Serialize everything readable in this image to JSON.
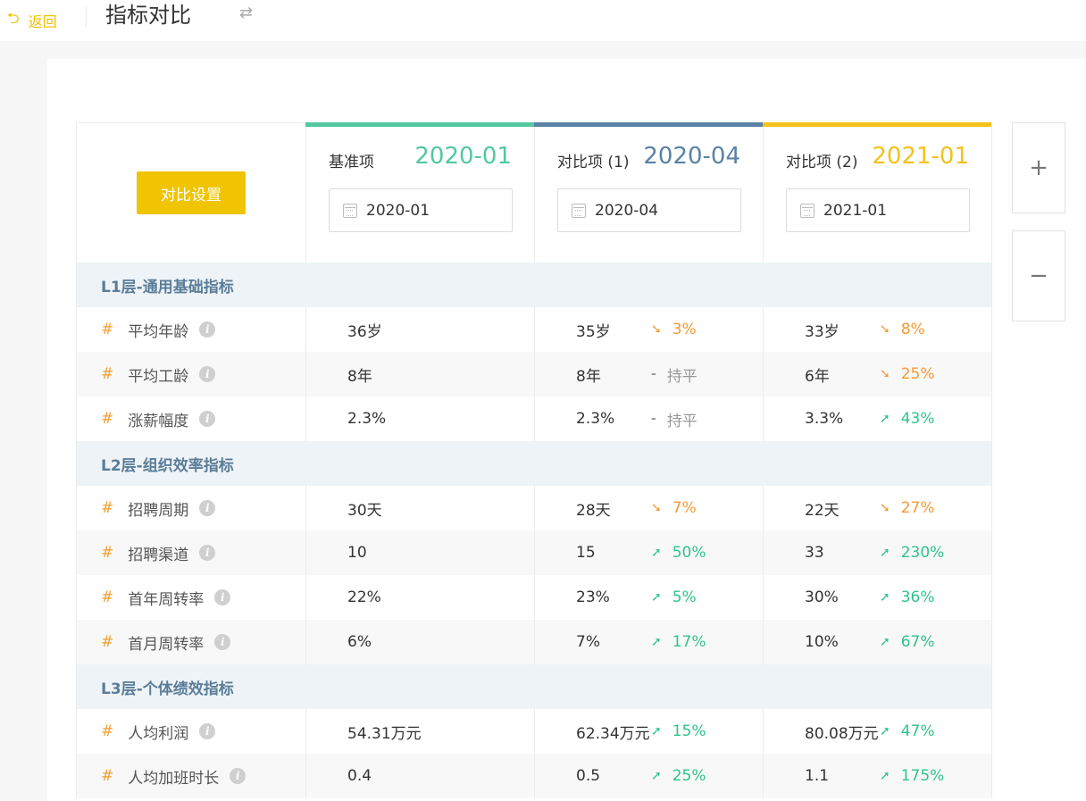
{
  "header": {
    "back_label": "返回",
    "title": "指标对比",
    "back_icon": "undo-arrow-icon",
    "swap_icon": "swap-arrows-icon"
  },
  "settings_button": "对比设置",
  "columns": [
    {
      "label": "基准项",
      "period": "2020-01",
      "picker_value": "2020-01",
      "color": "#52c8a0"
    },
    {
      "label": "对比项 (1)",
      "period": "2020-04",
      "picker_value": "2020-04",
      "color": "#5a82a6"
    },
    {
      "label": "对比项 (2)",
      "period": "2021-01",
      "picker_value": "2021-01",
      "color": "#f3c21b"
    }
  ],
  "sections": [
    {
      "title": "L1层-通用基础指标",
      "rows": [
        {
          "name": "平均年龄",
          "base": "36岁",
          "c1": {
            "value": "35岁",
            "dir": "down",
            "change": "3%"
          },
          "c2": {
            "value": "33岁",
            "dir": "down",
            "change": "8%"
          }
        },
        {
          "name": "平均工龄",
          "base": "8年",
          "c1": {
            "value": "8年",
            "dir": "flat",
            "change": "持平"
          },
          "c2": {
            "value": "6年",
            "dir": "down",
            "change": "25%"
          }
        },
        {
          "name": "涨薪幅度",
          "base": "2.3%",
          "c1": {
            "value": "2.3%",
            "dir": "flat",
            "change": "持平"
          },
          "c2": {
            "value": "3.3%",
            "dir": "up",
            "change": "43%"
          }
        }
      ]
    },
    {
      "title": "L2层-组织效率指标",
      "rows": [
        {
          "name": "招聘周期",
          "base": "30天",
          "c1": {
            "value": "28天",
            "dir": "down",
            "change": "7%"
          },
          "c2": {
            "value": "22天",
            "dir": "down",
            "change": "27%"
          }
        },
        {
          "name": "招聘渠道",
          "base": "10",
          "c1": {
            "value": "15",
            "dir": "up",
            "change": "50%"
          },
          "c2": {
            "value": "33",
            "dir": "up",
            "change": "230%"
          }
        },
        {
          "name": "首年周转率",
          "base": "22%",
          "c1": {
            "value": "23%",
            "dir": "up",
            "change": "5%"
          },
          "c2": {
            "value": "30%",
            "dir": "up",
            "change": "36%"
          }
        },
        {
          "name": "首月周转率",
          "base": "6%",
          "c1": {
            "value": "7%",
            "dir": "up",
            "change": "17%"
          },
          "c2": {
            "value": "10%",
            "dir": "up",
            "change": "67%"
          }
        }
      ]
    },
    {
      "title": "L3层-个体绩效指标",
      "rows": [
        {
          "name": "人均利润",
          "base": "54.31万元",
          "c1": {
            "value": "62.34万元",
            "dir": "up",
            "change": "15%"
          },
          "c2": {
            "value": "80.08万元",
            "dir": "up",
            "change": "47%"
          }
        },
        {
          "name": "人均加班时长",
          "base": "0.4",
          "c1": {
            "value": "0.5",
            "dir": "up",
            "change": "25%"
          },
          "c2": {
            "value": "1.1",
            "dir": "up",
            "change": "175%"
          }
        }
      ]
    }
  ],
  "side_buttons": {
    "add": "+",
    "remove": "−"
  }
}
